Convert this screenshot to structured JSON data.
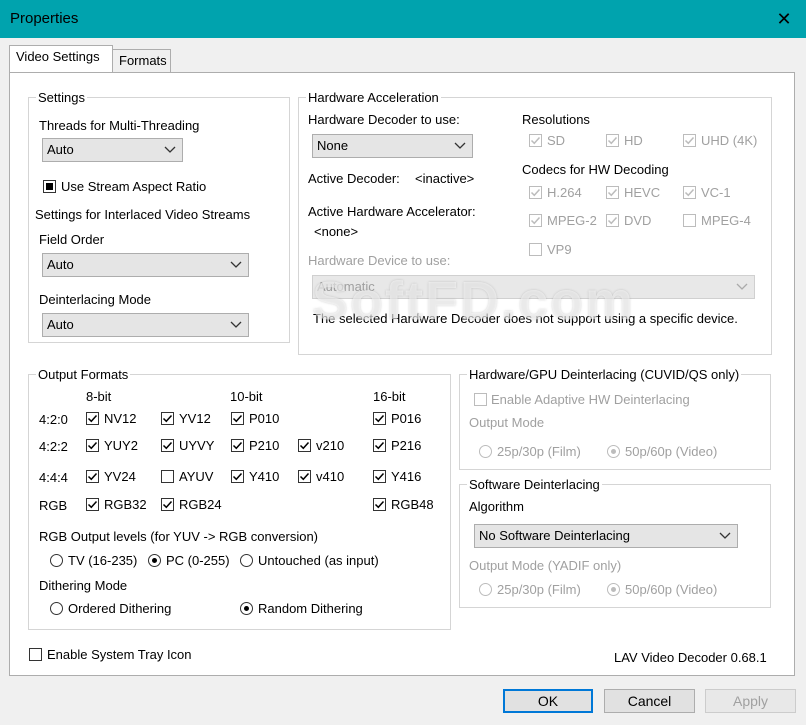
{
  "window": {
    "title": "Properties"
  },
  "tabs": [
    {
      "label": "Video Settings"
    },
    {
      "label": "Formats"
    }
  ],
  "settings": {
    "group_label": "Settings",
    "threads_label": "Threads for Multi-Threading",
    "threads_value": "Auto",
    "stream_aspect_label": "Use Stream Aspect Ratio",
    "interlaced_label": "Settings for Interlaced Video Streams",
    "field_order_label": "Field Order",
    "field_order_value": "Auto",
    "deint_mode_label": "Deinterlacing Mode",
    "deint_mode_value": "Auto"
  },
  "hw": {
    "group_label": "Hardware Acceleration",
    "decoder_label": "Hardware Decoder to use:",
    "decoder_value": "None",
    "active_decoder_label": "Active Decoder:",
    "active_decoder_value": "<inactive>",
    "active_accel_label": "Active Hardware Accelerator:",
    "active_accel_value": "<none>",
    "device_label": "Hardware Device to use:",
    "device_value": "Automatic",
    "device_note": "The selected Hardware Decoder does not support using a specific device.",
    "resolutions_label": "Resolutions",
    "res_sd": "SD",
    "res_hd": "HD",
    "res_uhd": "UHD (4K)",
    "codecs_label": "Codecs for HW Decoding",
    "c_h264": "H.264",
    "c_hevc": "HEVC",
    "c_vc1": "VC-1",
    "c_mpeg2": "MPEG-2",
    "c_dvd": "DVD",
    "c_mpeg4": "MPEG-4",
    "c_vp9": "VP9"
  },
  "output": {
    "group_label": "Output Formats",
    "h8": "8-bit",
    "h10": "10-bit",
    "h16": "16-bit",
    "r420": "4:2:0",
    "r422": "4:2:2",
    "r444": "4:4:4",
    "rrgb": "RGB",
    "nv12": "NV12",
    "yv12": "YV12",
    "p010": "P010",
    "p016": "P016",
    "yuy2": "YUY2",
    "uyvy": "UYVY",
    "p210": "P210",
    "v210": "v210",
    "p216": "P216",
    "yv24": "YV24",
    "ayuv": "AYUV",
    "y410": "Y410",
    "v410": "v410",
    "y416": "Y416",
    "rgb32": "RGB32",
    "rgb24": "RGB24",
    "rgb48": "RGB48",
    "levels_label": "RGB Output levels (for YUV -> RGB conversion)",
    "lvl_tv": "TV (16-235)",
    "lvl_pc": "PC (0-255)",
    "lvl_untouched": "Untouched (as input)",
    "dither_label": "Dithering Mode",
    "dither_ordered": "Ordered Dithering",
    "dither_random": "Random Dithering"
  },
  "hwdeint": {
    "group_label": "Hardware/GPU Deinterlacing (CUVID/QS only)",
    "adaptive": "Enable Adaptive HW Deinterlacing",
    "output_mode": "Output Mode",
    "film": "25p/30p (Film)",
    "video": "50p/60p (Video)"
  },
  "swdeint": {
    "group_label": "Software Deinterlacing",
    "algorithm_label": "Algorithm",
    "algorithm_value": "No Software Deinterlacing",
    "output_mode": "Output Mode (YADIF only)",
    "film": "25p/30p (Film)",
    "video": "50p/60p (Video)"
  },
  "footer": {
    "tray": "Enable System Tray Icon",
    "version": "LAV Video Decoder 0.68.1"
  },
  "buttons": {
    "ok": "OK",
    "cancel": "Cancel",
    "apply": "Apply"
  },
  "watermark": "SoftFD.com",
  "colors": {
    "titlebar": "#00a3ae",
    "accent": "#0078d7"
  }
}
